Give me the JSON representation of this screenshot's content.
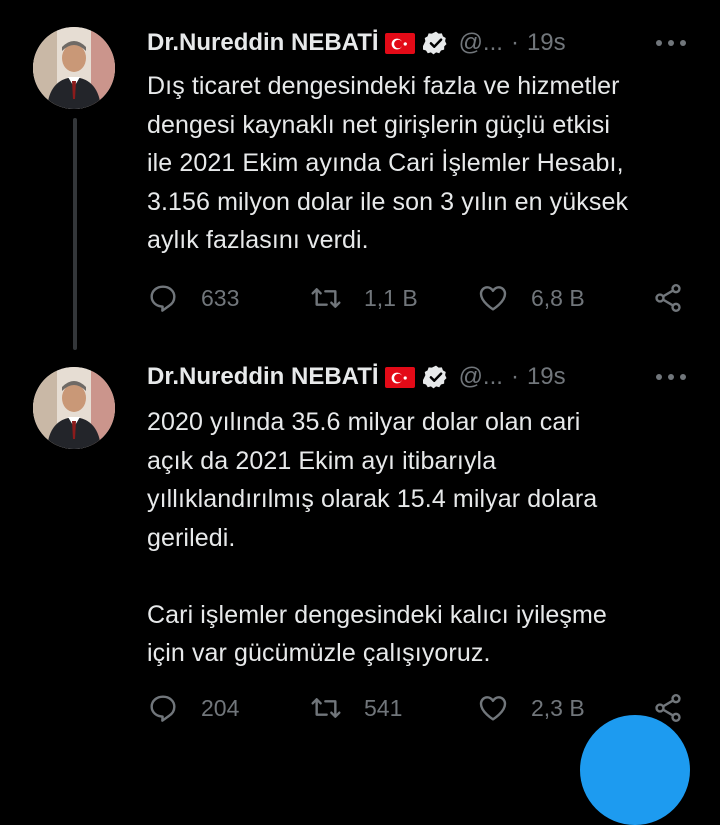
{
  "tweets": [
    {
      "author_name": "Dr.Nureddin NEBATİ",
      "handle": "@...",
      "separator": "·",
      "time": "19s",
      "text": "Dış ticaret dengesindeki fazla ve hizmetler\ndengesi kaynaklı net girişlerin güçlü etkisi\nile 2021 Ekim ayında Cari İşlemler Hesabı,\n3.156 milyon dolar ile son 3 yılın en yüksek\naylık fazlasını verdi.",
      "replies": "633",
      "retweets": "1,1 B",
      "likes": "6,8 B"
    },
    {
      "author_name": "Dr.Nureddin NEBATİ",
      "handle": "@...",
      "separator": "·",
      "time": "19s",
      "text": "2020 yılında 35.6 milyar dolar olan cari\naçık da 2021 Ekim ayı itibarıyla\nyıllıklandırılmış olarak 15.4 milyar dolara\ngeriledi.\n\nCari işlemler dengesindeki kalıcı iyileşme\niçin var gücümüzle çalışıyoruz.",
      "replies": "204",
      "retweets": "541",
      "likes": "2,3 B"
    }
  ],
  "icons": {
    "flag": "turkey-flag-icon",
    "verified": "verified-badge-icon",
    "reply": "reply-icon",
    "retweet": "retweet-icon",
    "like": "heart-icon",
    "share": "share-icon",
    "more": "more-icon"
  },
  "colors": {
    "background": "#000000",
    "text": "#e7e9ea",
    "muted": "#71767b",
    "accent": "#1d9bf0",
    "flag": "#e30a17"
  }
}
